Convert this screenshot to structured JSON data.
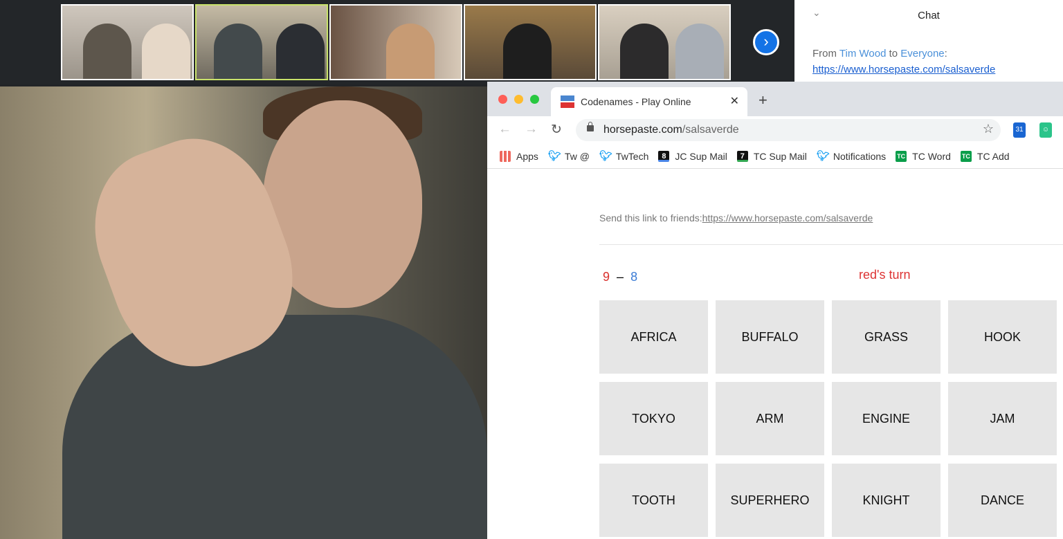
{
  "zoom": {
    "chat": {
      "title": "Chat",
      "from_prefix": "From ",
      "sender": "Tim Wood",
      "to_word": " to ",
      "recipient": "Everyone",
      "colon": ":",
      "link": "https://www.horsepaste.com/salsaverde"
    },
    "next_icon": "chevron-right-icon"
  },
  "browser": {
    "tab_title": "Codenames - Play Online",
    "url_host": "horsepaste.com",
    "url_path": "/salsaverde",
    "ext_calendar": "31",
    "bookmarks": [
      {
        "label": "Apps",
        "icon": "apps-grid-icon"
      },
      {
        "label": "Tw @",
        "icon": "twitter-icon"
      },
      {
        "label": "TwTech",
        "icon": "twitter-icon"
      },
      {
        "label": "JC Sup Mail",
        "icon": "8"
      },
      {
        "label": "TC Sup Mail",
        "icon": "7"
      },
      {
        "label": "Notifications",
        "icon": "twitter-icon"
      },
      {
        "label": "TC Word",
        "icon": "TC"
      },
      {
        "label": "TC Add",
        "icon": "TC"
      }
    ]
  },
  "game": {
    "share_text": "Send this link to friends:",
    "share_link": "https://www.horsepaste.com/salsaverde",
    "red_score": "9",
    "dash": "–",
    "blue_score": "8",
    "turn": "red's turn",
    "colors": {
      "red": "#d9302c",
      "blue": "#3a7bd5"
    },
    "cards": [
      "AFRICA",
      "BUFFALO",
      "GRASS",
      "HOOK",
      "TOKYO",
      "ARM",
      "ENGINE",
      "JAM",
      "TOOTH",
      "SUPERHERO",
      "KNIGHT",
      "DANCE"
    ]
  }
}
